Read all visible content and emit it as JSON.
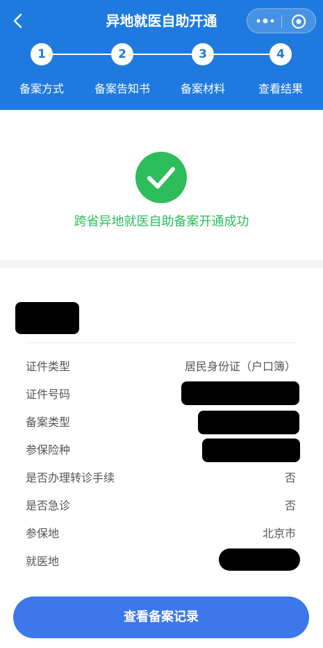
{
  "header": {
    "title": "异地就医自助开通",
    "steps": [
      {
        "number": "1",
        "label": "备案方式"
      },
      {
        "number": "2",
        "label": "备案告知书"
      },
      {
        "number": "3",
        "label": "备案材料"
      },
      {
        "number": "4",
        "label": "查看结果"
      }
    ]
  },
  "result": {
    "message": "跨省异地就医自助备案开通成功"
  },
  "details": {
    "rows": [
      {
        "key": "证件类型",
        "value": "居民身份证（户口簿）"
      },
      {
        "key": "证件号码",
        "value": ""
      },
      {
        "key": "备案类型",
        "value": ""
      },
      {
        "key": "参保险种",
        "value": ""
      },
      {
        "key": "是否办理转诊手续",
        "value": "否"
      },
      {
        "key": "是否急诊",
        "value": "否"
      },
      {
        "key": "参保地",
        "value": "北京市"
      },
      {
        "key": "就医地",
        "value": ""
      }
    ]
  },
  "actions": {
    "view_records": "查看备案记录"
  },
  "colors": {
    "header_bg": "#1f7ae0",
    "success_green": "#2dbd5b",
    "button_blue": "#3c78ea"
  },
  "icons": [
    "back-arrow-icon",
    "more-dots-icon",
    "close-target-icon",
    "check-icon"
  ]
}
